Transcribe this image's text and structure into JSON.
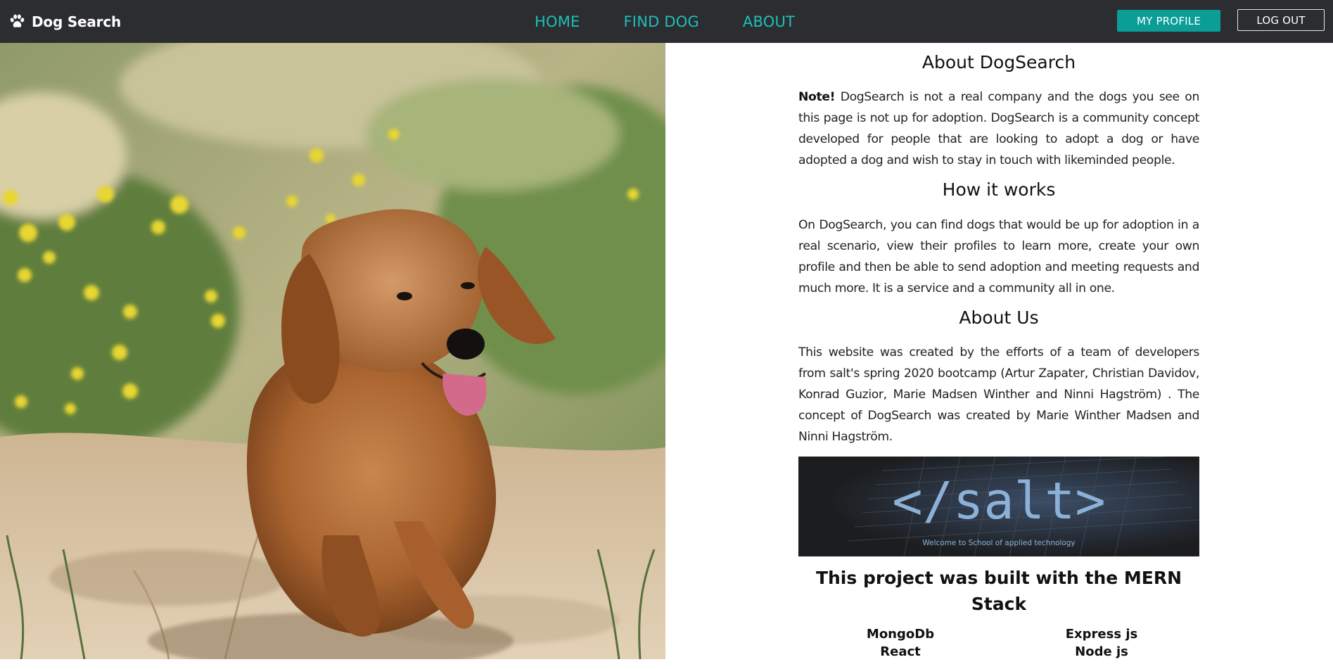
{
  "navbar": {
    "brand_icon": "paw-icon",
    "brand": "Dog Search",
    "links": [
      "HOME",
      "FIND DOG",
      "ABOUT"
    ],
    "my_profile": "MY PROFILE",
    "log_out": "LOG OUT",
    "accent_color": "#1fbfb8",
    "profile_button_color": "#0a9e96"
  },
  "about": {
    "title": "About DogSearch",
    "note_label": "Note!",
    "note_text": " DogSearch is not a real company and the dogs you see on this page is not up for adoption. DogSearch is a community concept developed for people that are looking to adopt a dog or have adopted a dog and wish to stay in touch with likeminded people."
  },
  "how_it_works": {
    "title": "How it works",
    "text": "On DogSearch, you can find dogs that would be up for adoption in a real scenario, view their profiles to learn more, create your own profile and then be able to send adoption and meeting requests and much more. It is a service and a community all in one."
  },
  "about_us": {
    "title": "About Us",
    "text": "This website was created by the efforts of a team of developers from salt's spring 2020 bootcamp (Artur Zapater, Christian Davidov, Konrad Guzior, Marie Madsen Winther and Ninni Hagström) . The concept of DogSearch was created by Marie Winther Madsen and Ninni Hagström."
  },
  "salt_banner": {
    "logo_text": "</salt>",
    "tagline": "Welcome to School of applied technology"
  },
  "mern": {
    "title": "This project was built with the MERN Stack",
    "tech": [
      "MongoDb",
      "Express js",
      "React",
      "Node js"
    ]
  }
}
